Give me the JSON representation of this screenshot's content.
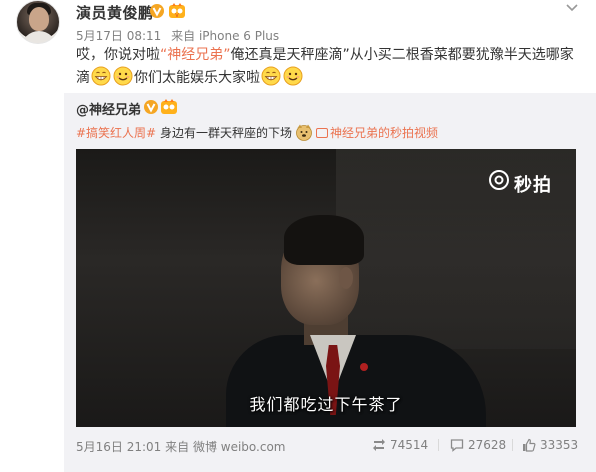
{
  "post": {
    "username": "演员黄俊鹏",
    "date": "5月17日 08:11",
    "source": "来自 iPhone 6 Plus",
    "text_part1": "哎，你说对啦",
    "text_link": "“神经兄弟”",
    "text_part2": "俺还真是天秤座滴”从小买二根香菜都要犹豫半天选哪家",
    "text_part3": "滴",
    "text_part4": "你们太能娱乐大家啦",
    "emojis": [
      "grin-emoji",
      "smile-emoji",
      "grin-emoji",
      "smile-emoji"
    ]
  },
  "repost": {
    "username": "@神经兄弟",
    "topic": "#搞笑红人周#",
    "text": "身边有一群天秤座的下场",
    "video_link": "神经兄弟的秒拍视频",
    "watermark": "秒拍",
    "subtitle": "我们都吃过下午茶了",
    "time": "5月16日 21:01",
    "source": "来自 微博 weibo.com",
    "reposts": "74514",
    "comments": "27628",
    "likes": "33353"
  },
  "colors": {
    "accent": "#eb7350",
    "verified": "#f5a623",
    "repost_bg": "#f2f2f5"
  }
}
